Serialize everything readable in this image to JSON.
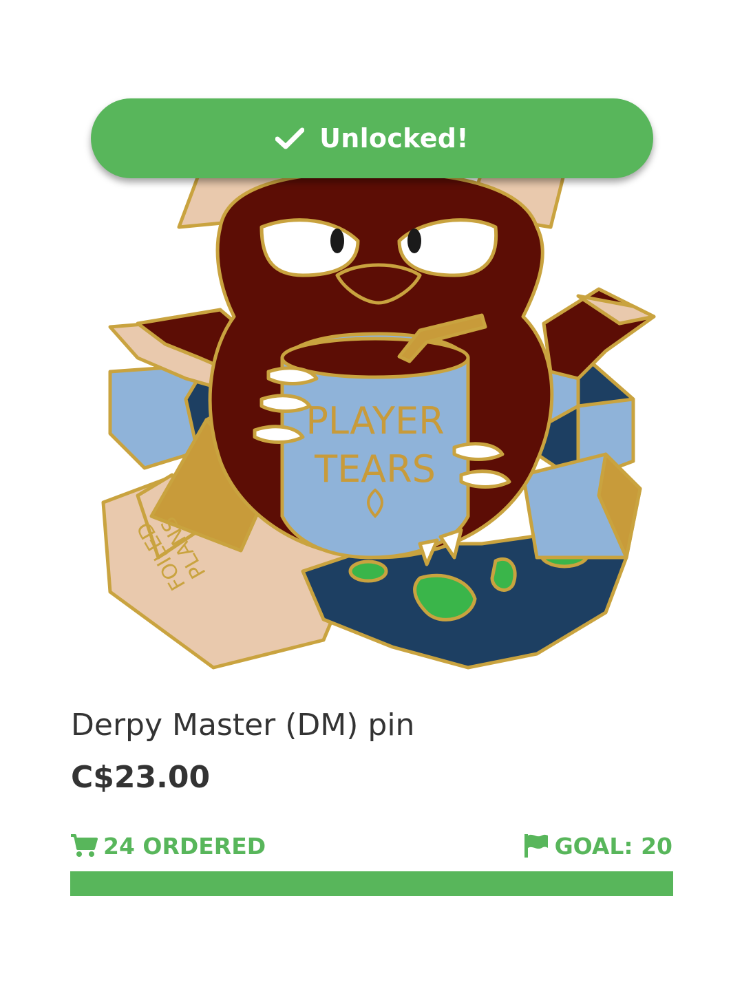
{
  "banner": {
    "label": "Unlocked!",
    "icon": "check-icon",
    "color": "#58b65b"
  },
  "product": {
    "title": "Derpy Master (DM) pin",
    "price": "C$23.00",
    "image_text": {
      "jar_label_line1": "PLAYER",
      "jar_label_line2": "TEARS",
      "paper_label_line1": "FOILED",
      "paper_label_line2": "PLANS"
    }
  },
  "stats": {
    "ordered_label": "24 ORDERED",
    "ordered_icon": "cart-icon",
    "goal_label": "GOAL: 20",
    "goal_icon": "flag-icon"
  },
  "progress": {
    "fraction": 1.0,
    "color": "#58b65b"
  }
}
